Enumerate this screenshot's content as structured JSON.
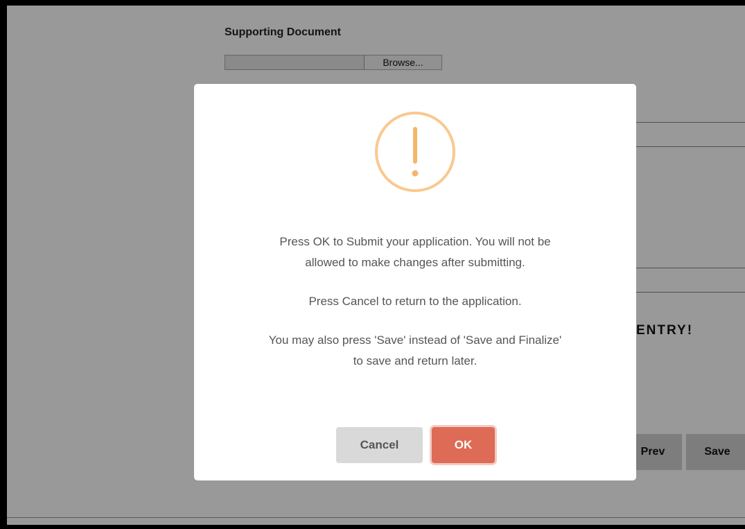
{
  "form": {
    "supporting_document_label": "Supporting Document",
    "browse_label": "Browse...",
    "entry_text": "ENTRY!",
    "prev_label": "Prev",
    "save_label": "Save"
  },
  "dialog": {
    "icon": "exclamation-circle-icon",
    "line1": "Press OK to Submit your application. You will not be",
    "line2": "allowed to make changes after submitting.",
    "line3": "Press Cancel to return to the application.",
    "line4": "You may also press 'Save' instead of 'Save and Finalize'",
    "line5": "to save and return later.",
    "cancel_label": "Cancel",
    "ok_label": "OK"
  },
  "colors": {
    "ok_button": "#dd6b55",
    "cancel_button": "#d9d9d9",
    "warning_icon": "#f8c990"
  }
}
